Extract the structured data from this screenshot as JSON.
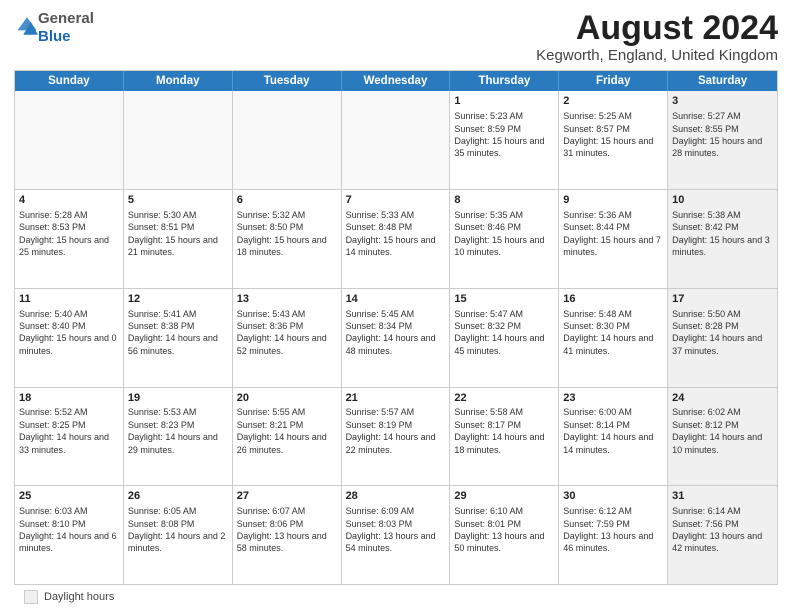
{
  "header": {
    "logo": {
      "line1": "General",
      "line2": "Blue"
    },
    "title": "August 2024",
    "location": "Kegworth, England, United Kingdom"
  },
  "calendar": {
    "days_of_week": [
      "Sunday",
      "Monday",
      "Tuesday",
      "Wednesday",
      "Thursday",
      "Friday",
      "Saturday"
    ],
    "rows": [
      {
        "cells": [
          {
            "day": "",
            "empty": true
          },
          {
            "day": "",
            "empty": true
          },
          {
            "day": "",
            "empty": true
          },
          {
            "day": "",
            "empty": true
          },
          {
            "day": "1",
            "sunrise": "5:23 AM",
            "sunset": "8:59 PM",
            "daylight": "15 hours and 35 minutes."
          },
          {
            "day": "2",
            "sunrise": "5:25 AM",
            "sunset": "8:57 PM",
            "daylight": "15 hours and 31 minutes."
          },
          {
            "day": "3",
            "sunrise": "5:27 AM",
            "sunset": "8:55 PM",
            "daylight": "15 hours and 28 minutes.",
            "shaded": true
          }
        ]
      },
      {
        "cells": [
          {
            "day": "4",
            "sunrise": "5:28 AM",
            "sunset": "8:53 PM",
            "daylight": "15 hours and 25 minutes."
          },
          {
            "day": "5",
            "sunrise": "5:30 AM",
            "sunset": "8:51 PM",
            "daylight": "15 hours and 21 minutes."
          },
          {
            "day": "6",
            "sunrise": "5:32 AM",
            "sunset": "8:50 PM",
            "daylight": "15 hours and 18 minutes."
          },
          {
            "day": "7",
            "sunrise": "5:33 AM",
            "sunset": "8:48 PM",
            "daylight": "15 hours and 14 minutes."
          },
          {
            "day": "8",
            "sunrise": "5:35 AM",
            "sunset": "8:46 PM",
            "daylight": "15 hours and 10 minutes."
          },
          {
            "day": "9",
            "sunrise": "5:36 AM",
            "sunset": "8:44 PM",
            "daylight": "15 hours and 7 minutes."
          },
          {
            "day": "10",
            "sunrise": "5:38 AM",
            "sunset": "8:42 PM",
            "daylight": "15 hours and 3 minutes.",
            "shaded": true
          }
        ]
      },
      {
        "cells": [
          {
            "day": "11",
            "sunrise": "5:40 AM",
            "sunset": "8:40 PM",
            "daylight": "15 hours and 0 minutes."
          },
          {
            "day": "12",
            "sunrise": "5:41 AM",
            "sunset": "8:38 PM",
            "daylight": "14 hours and 56 minutes."
          },
          {
            "day": "13",
            "sunrise": "5:43 AM",
            "sunset": "8:36 PM",
            "daylight": "14 hours and 52 minutes."
          },
          {
            "day": "14",
            "sunrise": "5:45 AM",
            "sunset": "8:34 PM",
            "daylight": "14 hours and 48 minutes."
          },
          {
            "day": "15",
            "sunrise": "5:47 AM",
            "sunset": "8:32 PM",
            "daylight": "14 hours and 45 minutes."
          },
          {
            "day": "16",
            "sunrise": "5:48 AM",
            "sunset": "8:30 PM",
            "daylight": "14 hours and 41 minutes."
          },
          {
            "day": "17",
            "sunrise": "5:50 AM",
            "sunset": "8:28 PM",
            "daylight": "14 hours and 37 minutes.",
            "shaded": true
          }
        ]
      },
      {
        "cells": [
          {
            "day": "18",
            "sunrise": "5:52 AM",
            "sunset": "8:25 PM",
            "daylight": "14 hours and 33 minutes."
          },
          {
            "day": "19",
            "sunrise": "5:53 AM",
            "sunset": "8:23 PM",
            "daylight": "14 hours and 29 minutes."
          },
          {
            "day": "20",
            "sunrise": "5:55 AM",
            "sunset": "8:21 PM",
            "daylight": "14 hours and 26 minutes."
          },
          {
            "day": "21",
            "sunrise": "5:57 AM",
            "sunset": "8:19 PM",
            "daylight": "14 hours and 22 minutes."
          },
          {
            "day": "22",
            "sunrise": "5:58 AM",
            "sunset": "8:17 PM",
            "daylight": "14 hours and 18 minutes."
          },
          {
            "day": "23",
            "sunrise": "6:00 AM",
            "sunset": "8:14 PM",
            "daylight": "14 hours and 14 minutes."
          },
          {
            "day": "24",
            "sunrise": "6:02 AM",
            "sunset": "8:12 PM",
            "daylight": "14 hours and 10 minutes.",
            "shaded": true
          }
        ]
      },
      {
        "cells": [
          {
            "day": "25",
            "sunrise": "6:03 AM",
            "sunset": "8:10 PM",
            "daylight": "14 hours and 6 minutes."
          },
          {
            "day": "26",
            "sunrise": "6:05 AM",
            "sunset": "8:08 PM",
            "daylight": "14 hours and 2 minutes."
          },
          {
            "day": "27",
            "sunrise": "6:07 AM",
            "sunset": "8:06 PM",
            "daylight": "13 hours and 58 minutes."
          },
          {
            "day": "28",
            "sunrise": "6:09 AM",
            "sunset": "8:03 PM",
            "daylight": "13 hours and 54 minutes."
          },
          {
            "day": "29",
            "sunrise": "6:10 AM",
            "sunset": "8:01 PM",
            "daylight": "13 hours and 50 minutes."
          },
          {
            "day": "30",
            "sunrise": "6:12 AM",
            "sunset": "7:59 PM",
            "daylight": "13 hours and 46 minutes."
          },
          {
            "day": "31",
            "sunrise": "6:14 AM",
            "sunset": "7:56 PM",
            "daylight": "13 hours and 42 minutes.",
            "shaded": true
          }
        ]
      }
    ]
  },
  "legend": {
    "label": "Daylight hours"
  }
}
